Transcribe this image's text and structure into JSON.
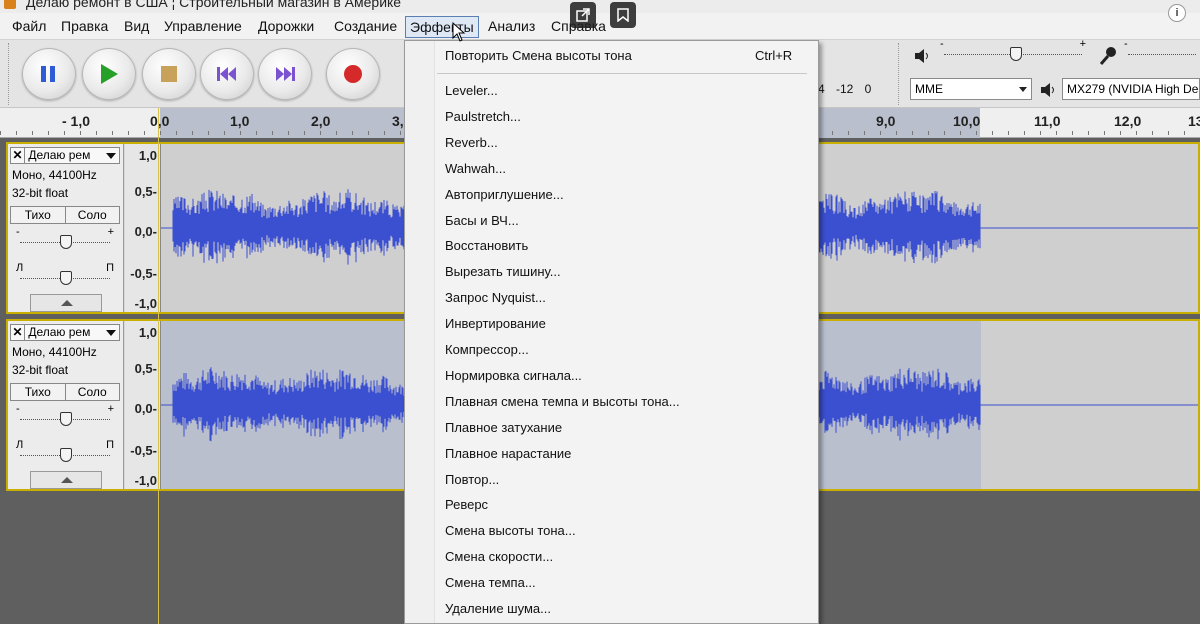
{
  "window": {
    "title": "Делаю ремонт в США ¦ Строительный магазин в Америке"
  },
  "menubar": {
    "items": [
      {
        "label": "Файл"
      },
      {
        "label": "Правка"
      },
      {
        "label": "Вид"
      },
      {
        "label": "Управление"
      },
      {
        "label": "Дорожки"
      },
      {
        "label": "Создание"
      },
      {
        "label": "Эффекты"
      },
      {
        "label": "Анализ"
      },
      {
        "label": "Справка"
      }
    ],
    "active": "Эффекты"
  },
  "transport": {
    "buttons": [
      "pause-icon",
      "play-icon",
      "stop-icon",
      "skip-start-icon",
      "skip-end-icon",
      "record-icon"
    ]
  },
  "meter": {
    "labels": "4 -12 0"
  },
  "devices": {
    "host": "MME",
    "output": "MX279 (NVIDIA High De"
  },
  "ruler": {
    "ticks": [
      "- 1,0",
      "0,0",
      "1,0",
      "2,0",
      "3,",
      "9,0",
      "10,0",
      "11,0",
      "12,0",
      "13"
    ]
  },
  "tracks": [
    {
      "name": "Делаю рем",
      "format": "Моно, 44100Hz",
      "depth": "32-bit float",
      "mute": "Тихо",
      "solo": "Соло",
      "gain_minus": "-",
      "gain_plus": "+",
      "pan_left": "Л",
      "pan_right": "П",
      "scale": [
        "1,0",
        "0,5-",
        "0,0-",
        "-0,5-",
        "-1,0"
      ]
    },
    {
      "name": "Делаю рем",
      "format": "Моно, 44100Hz",
      "depth": "32-bit float",
      "mute": "Тихо",
      "solo": "Соло",
      "gain_minus": "-",
      "gain_plus": "+",
      "pan_left": "Л",
      "pan_right": "П",
      "scale": [
        "1,0",
        "0,5-",
        "0,0-",
        "-0,5-",
        "-1,0"
      ]
    }
  ],
  "effects_menu": {
    "repeat": {
      "label": "Повторить Смена высоты тона",
      "shortcut": "Ctrl+R"
    },
    "items": [
      "Leveler...",
      "Paulstretch...",
      "Reverb...",
      "Wahwah...",
      "Автоприглушение...",
      "Басы и ВЧ...",
      "Восстановить",
      "Вырезать тишину...",
      "Запрос Nyquist...",
      "Инвертирование",
      "Компрессор...",
      "Нормировка сигнала...",
      "Плавная смена темпа и высоты тона...",
      "Плавное затухание",
      "Плавное нарастание",
      "Повтор...",
      "Реверс",
      "Смена высоты тона...",
      "Смена скорости...",
      "Смена темпа...",
      "Удаление шума..."
    ]
  },
  "overlay": {
    "info": "i"
  },
  "colors": {
    "waveform": "#3b4fd1",
    "selection": "#b9bfcc",
    "track_border": "#c9b000"
  }
}
